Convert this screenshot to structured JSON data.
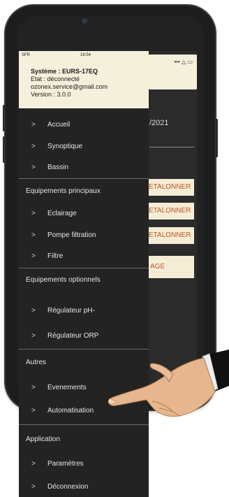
{
  "status_bar": {
    "carrier": "SFR",
    "time": "16:54",
    "right_icons": "••• △ ▭"
  },
  "header": {
    "system": "Système : EURS-17EQ",
    "state": "Etat : déconnecté",
    "email": "ozonex.service@gmail.com",
    "version": "Version : 3.0.0"
  },
  "menu": {
    "top_items": [
      "Accueil",
      "Synoptique",
      "Bassin"
    ],
    "sections": [
      {
        "title": "Equipements principaux",
        "items": [
          "Eclairage",
          "Pompe filtration",
          "Filtre"
        ]
      },
      {
        "title": "Equipements optionnels",
        "items": [
          "Régulateur pH-",
          "Régulateur ORP"
        ]
      },
      {
        "title": "Autres",
        "items": [
          "Evenements",
          "Automatisation"
        ]
      },
      {
        "title": "Application",
        "items": [
          "Paramètres",
          "Déconnexion"
        ]
      }
    ],
    "chevron": ">"
  },
  "background": {
    "date_fragment": "/2021",
    "etalonner_label": "ETALONNER",
    "button_fragment": "AGE"
  },
  "colors": {
    "accent": "#c0561d",
    "drawer_bg": "#232323",
    "header_bg": "#f5f0dc"
  }
}
